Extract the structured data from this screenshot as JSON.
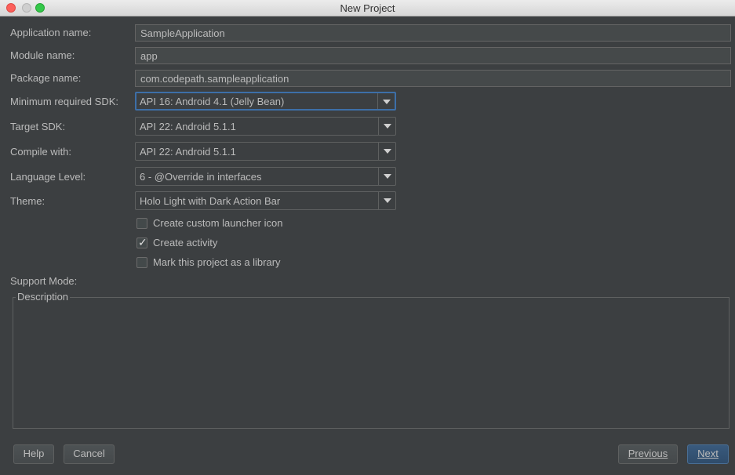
{
  "window": {
    "title": "New Project"
  },
  "form": {
    "application_name": {
      "label": "Application name:",
      "value": "SampleApplication"
    },
    "module_name": {
      "label": "Module name:",
      "value": "app"
    },
    "package_name": {
      "label": "Package name:",
      "value": "com.codepath.sampleapplication"
    },
    "min_sdk": {
      "label": "Minimum required SDK:",
      "value": "API 16: Android 4.1 (Jelly Bean)"
    },
    "target_sdk": {
      "label": "Target SDK:",
      "value": "API 22: Android 5.1.1"
    },
    "compile_with": {
      "label": "Compile with:",
      "value": "API 22: Android 5.1.1"
    },
    "language_level": {
      "label": "Language Level:",
      "value": "6 - @Override in interfaces"
    },
    "theme": {
      "label": "Theme:",
      "value": "Holo Light with Dark Action Bar"
    },
    "options": [
      {
        "label": "Create custom launcher icon",
        "checked": false
      },
      {
        "label": "Create activity",
        "checked": true
      },
      {
        "label": "Mark this project as a library",
        "checked": false
      }
    ],
    "support_mode": {
      "label": "Support Mode:"
    },
    "description": {
      "title": "Description"
    }
  },
  "buttons": {
    "help": "Help",
    "cancel": "Cancel",
    "previous": "Previous",
    "next": "Next"
  },
  "icons": {
    "dropdown": "chevron-down-icon",
    "checkmark": "check-icon"
  },
  "colors": {
    "background": "#3c3f41",
    "focus_border": "#3d6fa8",
    "primary_button": "#365880"
  }
}
